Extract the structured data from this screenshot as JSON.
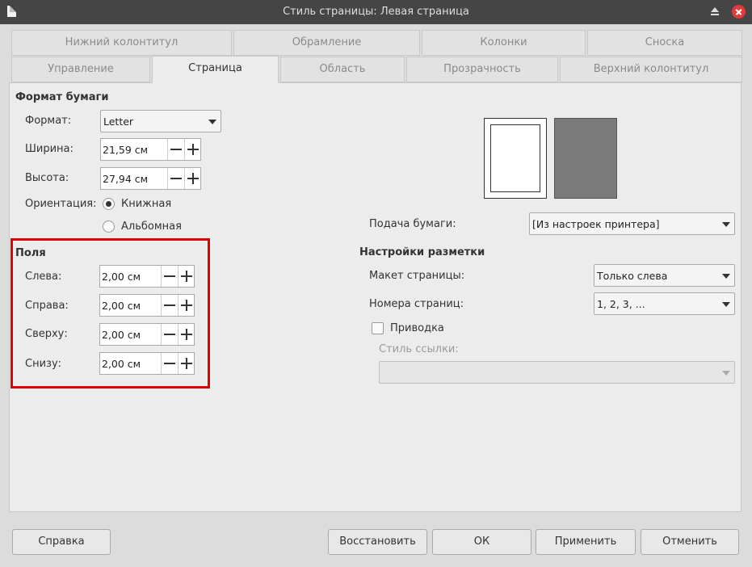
{
  "window": {
    "title": "Стиль страницы: Левая страница",
    "icons": [
      "document-icon",
      "maximize-icon",
      "close-icon"
    ]
  },
  "tabs": {
    "row1": [
      "Нижний колонтитул",
      "Обрамление",
      "Колонки",
      "Сноска"
    ],
    "row2": [
      "Управление",
      "Страница",
      "Область",
      "Прозрачность",
      "Верхний колонтитул"
    ],
    "active": "Страница"
  },
  "paper_format": {
    "heading": "Формат бумаги",
    "format_label": "Формат:",
    "format_value": "Letter",
    "width_label": "Ширина:",
    "width_value": "21,59 см",
    "height_label": "Высота:",
    "height_value": "27,94 см",
    "orientation_label": "Ориентация:",
    "portrait_label": "Книжная",
    "landscape_label": "Альбомная",
    "orientation_selected": "portrait"
  },
  "margins": {
    "heading": "Поля",
    "left_label": "Слева:",
    "left_value": "2,00 см",
    "right_label": "Справа:",
    "right_value": "2,00 см",
    "top_label": "Сверху:",
    "top_value": "2,00 см",
    "bottom_label": "Снизу:",
    "bottom_value": "2,00 см"
  },
  "paper_tray": {
    "label": "Подача бумаги:",
    "value": "[Из настроек принтера]"
  },
  "layout_settings": {
    "heading": "Настройки разметки",
    "page_layout_label": "Макет страницы:",
    "page_layout_value": "Только слева",
    "page_numbers_label": "Номера страниц:",
    "page_numbers_value": "1, 2, 3, ...",
    "register_true_label": "Приводка",
    "register_true_checked": false,
    "reference_style_label": "Стиль ссылки:",
    "reference_style_value": ""
  },
  "footer": {
    "help": "Справка",
    "reset": "Восстановить",
    "ok": "ОК",
    "apply": "Применить",
    "cancel": "Отменить"
  },
  "colors": {
    "highlight": "#e00000",
    "titlebar": "#454545",
    "close": "#e03a3a"
  }
}
